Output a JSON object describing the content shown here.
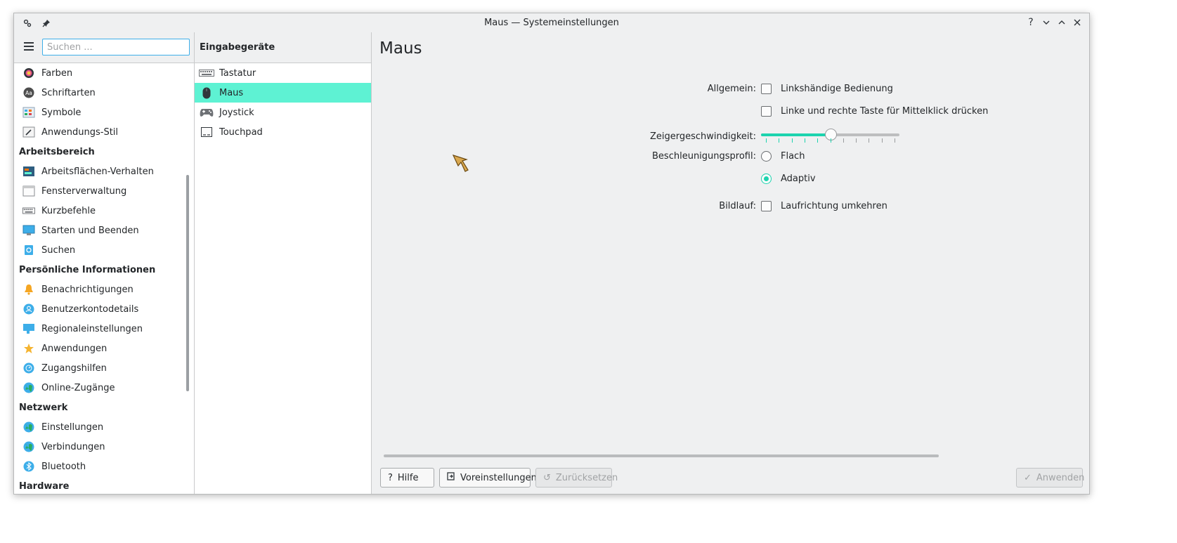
{
  "window": {
    "title": "Maus — Systemeinstellungen",
    "controls": [
      "?",
      "⌄",
      "⌃",
      "✕"
    ]
  },
  "search": {
    "placeholder": "Suchen ..."
  },
  "sidebar": {
    "items": [
      {
        "type": "item",
        "label": "Farben",
        "icon": "colors-icon"
      },
      {
        "type": "item",
        "label": "Schriftarten",
        "icon": "fonts-icon"
      },
      {
        "type": "item",
        "label": "Symbole",
        "icon": "icons-icon"
      },
      {
        "type": "item",
        "label": "Anwendungs-Stil",
        "icon": "app-style-icon"
      },
      {
        "type": "category",
        "label": "Arbeitsbereich"
      },
      {
        "type": "item",
        "label": "Arbeitsflächen-Verhalten",
        "icon": "desktop-behavior-icon"
      },
      {
        "type": "item",
        "label": "Fensterverwaltung",
        "icon": "window-management-icon"
      },
      {
        "type": "item",
        "label": "Kurzbefehle",
        "icon": "shortcuts-icon"
      },
      {
        "type": "item",
        "label": "Starten und Beenden",
        "icon": "startup-shutdown-icon"
      },
      {
        "type": "item",
        "label": "Suchen",
        "icon": "search-icon"
      },
      {
        "type": "category",
        "label": "Persönliche Informationen"
      },
      {
        "type": "item",
        "label": "Benachrichtigungen",
        "icon": "bell-icon"
      },
      {
        "type": "item",
        "label": "Benutzerkontodetails",
        "icon": "user-icon"
      },
      {
        "type": "item",
        "label": "Regionaleinstellungen",
        "icon": "regional-icon"
      },
      {
        "type": "item",
        "label": "Anwendungen",
        "icon": "star-icon"
      },
      {
        "type": "item",
        "label": "Zugangshilfen",
        "icon": "accessibility-icon"
      },
      {
        "type": "item",
        "label": "Online-Zugänge",
        "icon": "globe-icon"
      },
      {
        "type": "category",
        "label": "Netzwerk"
      },
      {
        "type": "item",
        "label": "Einstellungen",
        "icon": "globe-icon"
      },
      {
        "type": "item",
        "label": "Verbindungen",
        "icon": "globe-icon"
      },
      {
        "type": "item",
        "label": "Bluetooth",
        "icon": "bluetooth-icon"
      },
      {
        "type": "category",
        "label": "Hardware"
      }
    ]
  },
  "middle": {
    "header": "Eingabegeräte",
    "items": [
      {
        "label": "Tastatur",
        "icon": "keyboard-icon",
        "selected": false
      },
      {
        "label": "Maus",
        "icon": "mouse-icon",
        "selected": true
      },
      {
        "label": "Joystick",
        "icon": "gamepad-icon",
        "selected": false
      },
      {
        "label": "Touchpad",
        "icon": "touchpad-icon",
        "selected": false
      }
    ]
  },
  "content": {
    "title": "Maus",
    "general_label": "Allgemein:",
    "left_handed_label": "Linkshändige Bedienung",
    "left_handed_checked": false,
    "middle_click_label": "Linke und rechte Taste für Mittelklick drücken",
    "middle_click_checked": false,
    "pointer_speed_label": "Zeigergeschwindigkeit:",
    "pointer_speed_value": 0.5,
    "pointer_speed_ticks": 11,
    "accel_profile_label": "Beschleunigungsprofil:",
    "accel_flat_label": "Flach",
    "accel_adaptive_label": "Adaptiv",
    "accel_selected": "Adaptiv",
    "scrolling_label": "Bildlauf:",
    "invert_scroll_label": "Laufrichtung umkehren",
    "invert_scroll_checked": false
  },
  "buttons": {
    "help": "Hilfe",
    "defaults": "Voreinstellungen",
    "reset": "Zurücksetzen",
    "apply": "Anwenden"
  },
  "colors": {
    "accent": "#1cd3ae",
    "selection": "#5ef2d3",
    "focus": "#3daee9"
  }
}
